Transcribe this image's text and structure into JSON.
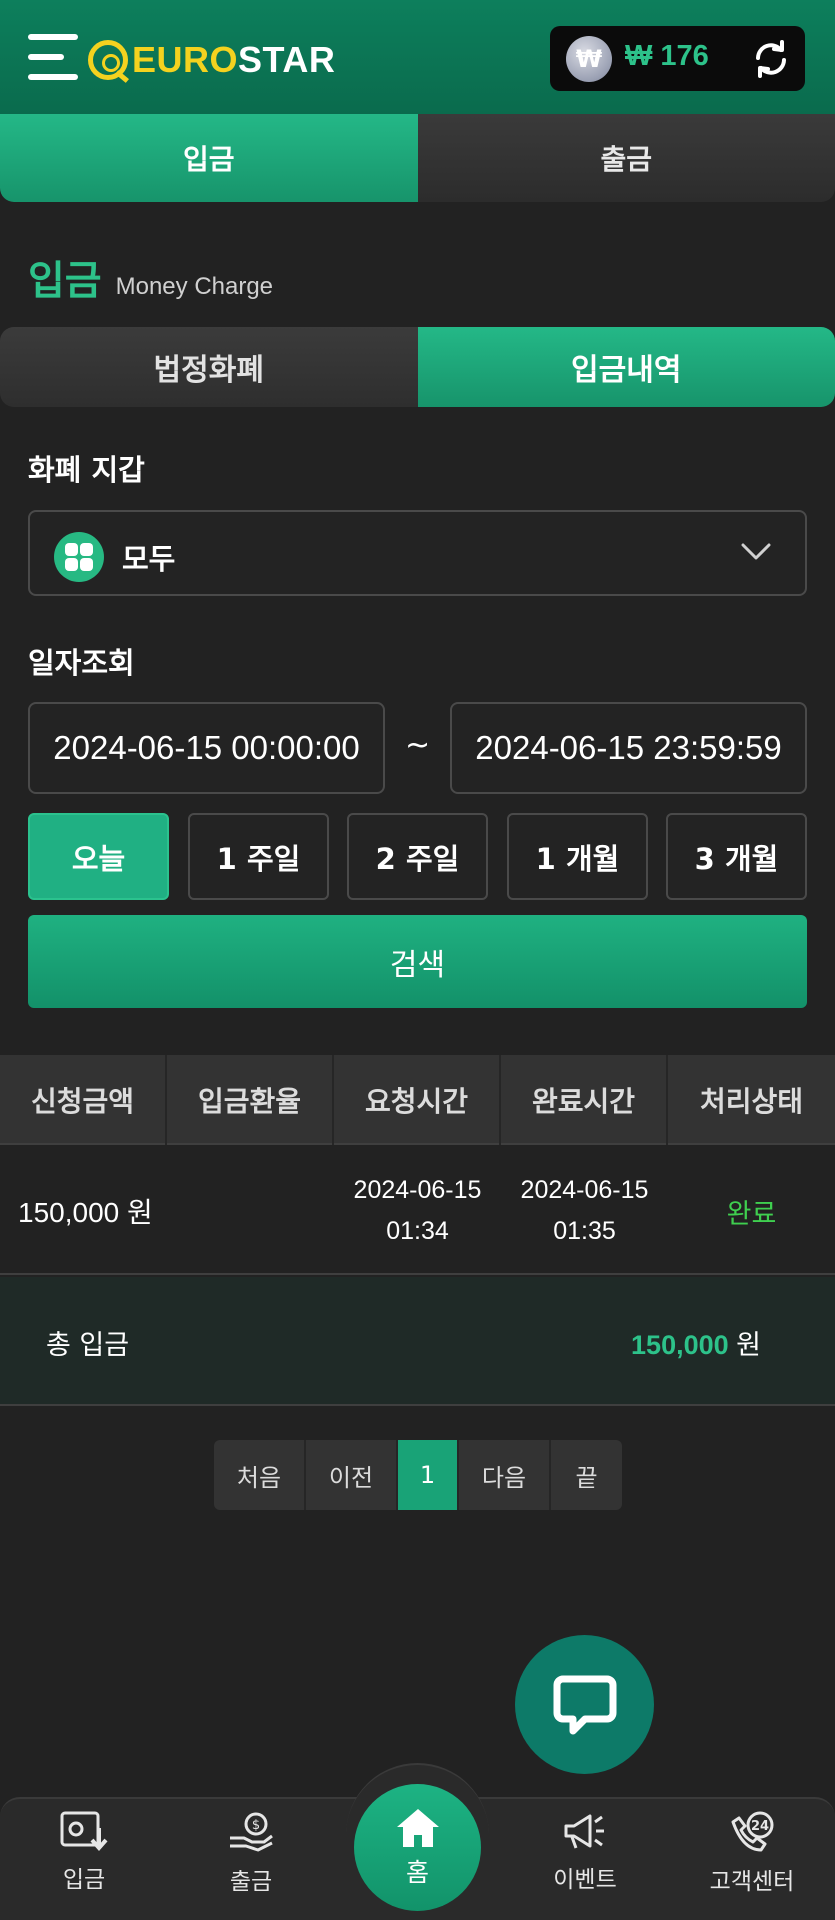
{
  "header": {
    "logo_euro": "EURO",
    "logo_star": "STAR",
    "currency_symbol": "₩",
    "balance": "₩ 176"
  },
  "main_tabs": [
    {
      "label": "입금",
      "active": true
    },
    {
      "label": "출금",
      "active": false
    }
  ],
  "page": {
    "title_ko": "입금",
    "title_en": "Money Charge"
  },
  "sub_tabs": [
    {
      "label": "법정화폐",
      "active": false
    },
    {
      "label": "입금내역",
      "active": true
    }
  ],
  "wallet": {
    "label": "화폐 지갑",
    "selected": "모두"
  },
  "date_query": {
    "label": "일자조회",
    "start": "2024-06-15 00:00:00",
    "separator": "~",
    "end": "2024-06-15 23:59:59"
  },
  "periods": [
    {
      "label": "오늘",
      "active": true
    },
    {
      "label": "1 주일",
      "active": false
    },
    {
      "label": "2 주일",
      "active": false
    },
    {
      "label": "1 개월",
      "active": false
    },
    {
      "label": "3 개월",
      "active": false
    }
  ],
  "search_label": "검색",
  "table": {
    "headers": [
      "신청금액",
      "입금환율",
      "요청시간",
      "완료시간",
      "처리상태"
    ],
    "rows": [
      {
        "amount": "150,000 원",
        "rate": "",
        "requested_date": "2024-06-15",
        "requested_time": "01:34",
        "completed_date": "2024-06-15",
        "completed_time": "01:35",
        "status": "완료"
      }
    ]
  },
  "total": {
    "label": "총 입금",
    "value": "150,000",
    "unit": "원"
  },
  "pagination": {
    "first": "처음",
    "prev": "이전",
    "current": "1",
    "next": "다음",
    "last": "끝"
  },
  "bottom_nav": {
    "deposit": "입금",
    "withdraw": "출금",
    "home": "홈",
    "event": "이벤트",
    "support": "고객센터",
    "support_badge": "24"
  },
  "colors": {
    "accent": "#1fb181",
    "header_bg": "#0d7f5c",
    "logo_yellow": "#f4d21f",
    "status_done": "#3fcf4f"
  }
}
